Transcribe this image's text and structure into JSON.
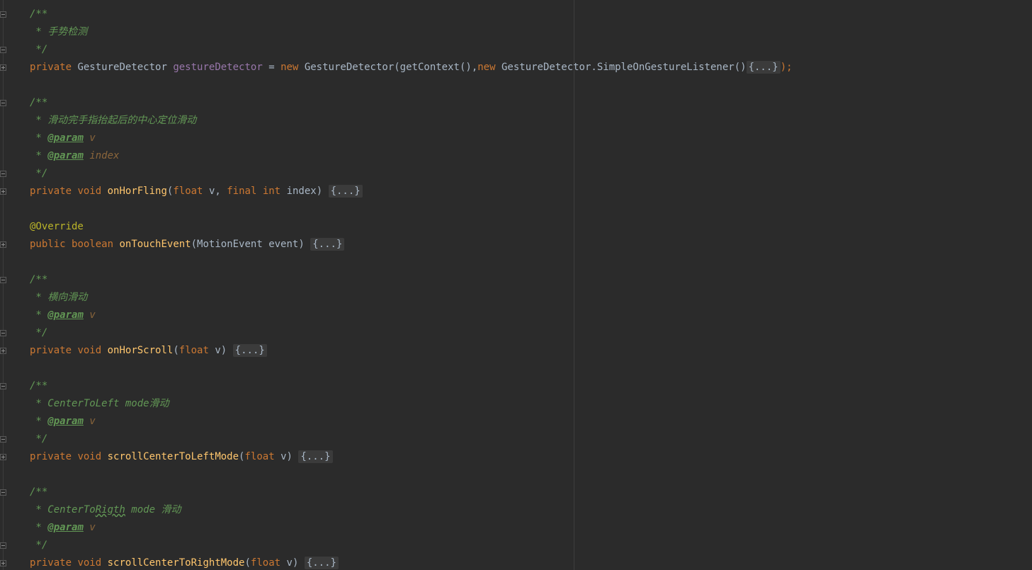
{
  "editor": {
    "lines": [
      {
        "doc": "/**"
      },
      {
        "doc": " * 手势检测"
      },
      {
        "doc": " */"
      },
      {
        "code": {
          "kw1": "private",
          "type": "GestureDetector",
          "field": "gestureDetector",
          "eq": "=",
          "kw2": "new",
          "ctor": "GestureDetector(getContext(),",
          "kw3": "new",
          "inner": "GestureDetector.SimpleOnGestureListener()",
          "folded": "{...}",
          "tail": ");"
        }
      },
      {
        "blank": ""
      },
      {
        "doc": "/**"
      },
      {
        "doc": " * 滑动完手指抬起后的中心定位滑动"
      },
      {
        "param": {
          "star": " * ",
          "tag": "@param",
          "name": "v"
        }
      },
      {
        "param": {
          "star": " * ",
          "tag": "@param",
          "name": "index"
        }
      },
      {
        "doc": " */"
      },
      {
        "method": {
          "mod": "private",
          "ret": "void",
          "name": "onHorFling",
          "params_kw1": "float",
          "p1": "v,",
          "params_kw2": "final",
          "params_kw3": "int",
          "p2": "index)",
          "folded": "{...}"
        }
      },
      {
        "blank": ""
      },
      {
        "annotation": "@Override"
      },
      {
        "method2": {
          "mod": "public",
          "ret": "boolean",
          "name": "onTouchEvent",
          "params": "(MotionEvent event)",
          "folded": "{...}"
        }
      },
      {
        "blank": ""
      },
      {
        "doc": "/**"
      },
      {
        "doc": " * 横向滑动"
      },
      {
        "param": {
          "star": " * ",
          "tag": "@param",
          "name": "v"
        }
      },
      {
        "doc": " */"
      },
      {
        "method3": {
          "mod": "private",
          "ret": "void",
          "name": "onHorScroll",
          "kw": "float",
          "p": "v)",
          "folded": "{...}"
        }
      },
      {
        "blank": ""
      },
      {
        "doc": "/**"
      },
      {
        "doc": " * CenterToLeft mode滑动"
      },
      {
        "param": {
          "star": " * ",
          "tag": "@param",
          "name": "v"
        }
      },
      {
        "doc": " */"
      },
      {
        "method3": {
          "mod": "private",
          "ret": "void",
          "name": "scrollCenterToLeftMode",
          "kw": "float",
          "p": "v)",
          "folded": "{...}"
        }
      },
      {
        "blank": ""
      },
      {
        "doc": "/**"
      },
      {
        "docTypo": {
          "pre": " * CenterTo",
          "typo": "Rigth",
          "post": " mode 滑动"
        }
      },
      {
        "param": {
          "star": " * ",
          "tag": "@param",
          "name": "v"
        }
      },
      {
        "doc": " */"
      },
      {
        "method3": {
          "mod": "private",
          "ret": "void",
          "name": "scrollCenterToRightMode",
          "kw": "float",
          "p": "v)",
          "folded": "{...}"
        }
      }
    ]
  },
  "colors": {
    "background": "#2b2b2b",
    "keyword": "#cc7832",
    "doc_comment": "#629755",
    "field": "#9876aa",
    "method": "#ffc66d",
    "annotation": "#bbb529",
    "plain": "#a9b7c6"
  },
  "icons": [
    "fold-collapse-icon",
    "fold-expand-icon"
  ]
}
